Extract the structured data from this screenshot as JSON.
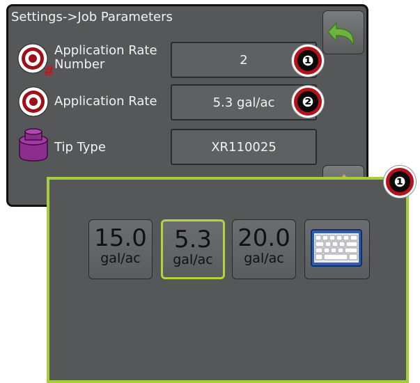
{
  "screen": {
    "breadcrumb": "Settings->Job Parameters",
    "rows": [
      {
        "label_line1": "Application Rate",
        "label_line2": "Number",
        "value": "2",
        "icon": "application-rate-number-icon"
      },
      {
        "label_line1": "Application Rate",
        "value": "5.3 gal/ac",
        "icon": "application-rate-icon"
      },
      {
        "label_line1": "Tip Type",
        "value": "XR110025",
        "icon": "nozzle-tip-icon"
      }
    ]
  },
  "callouts": [
    "❶",
    "❷",
    "❶"
  ],
  "popup": {
    "presets": [
      {
        "value": "15.0",
        "unit": "gal/ac",
        "selected": false
      },
      {
        "value": "5.3",
        "unit": "gal/ac",
        "selected": true
      },
      {
        "value": "20.0",
        "unit": "gal/ac",
        "selected": false
      }
    ],
    "keyboard_icon": "keyboard-icon"
  },
  "colors": {
    "panel": "#555759",
    "accent": "#a2cf3a",
    "callout": "#b5121b",
    "back_arrow": "#6fb33e"
  }
}
